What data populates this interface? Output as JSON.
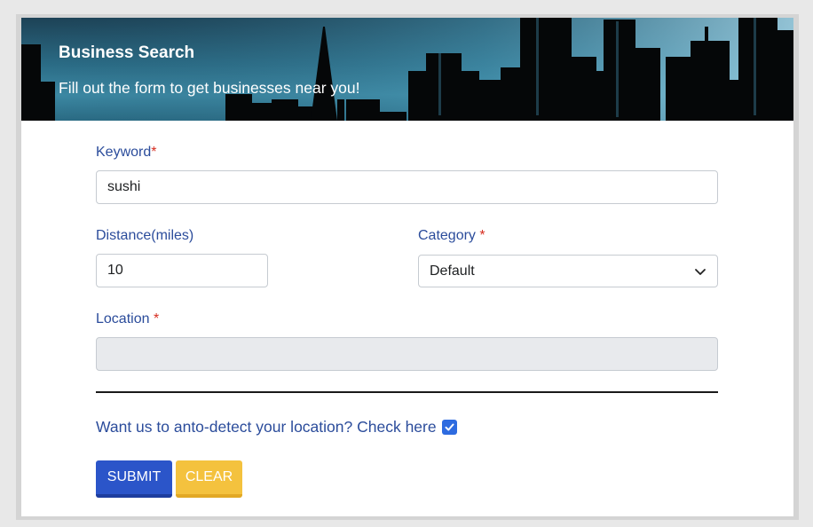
{
  "header": {
    "title": "Business Search",
    "subtitle": "Fill out the form to get businesses near you!"
  },
  "form": {
    "keyword": {
      "label": "Keyword",
      "required_mark": "*",
      "value": "sushi"
    },
    "distance": {
      "label": "Distance(miles)",
      "value": "10"
    },
    "category": {
      "label": "Category",
      "required_mark": "*",
      "selected": "Default"
    },
    "location": {
      "label": "Location",
      "required_mark": "*",
      "value": "",
      "disabled": true
    },
    "autodetect": {
      "label": "Want us to anto-detect your location? Check here",
      "checked": true
    },
    "buttons": {
      "submit": "SUBMIT",
      "clear": "CLEAR"
    }
  },
  "colors": {
    "label_blue": "#2b4c9b",
    "required_red": "#d62d20",
    "submit_blue": "#2b55c9",
    "clear_yellow": "#f4c23e",
    "checkbox_blue": "#2d6be0"
  },
  "icons": {
    "select_arrow": "chevron-down-icon",
    "checkbox_mark": "check-icon"
  }
}
